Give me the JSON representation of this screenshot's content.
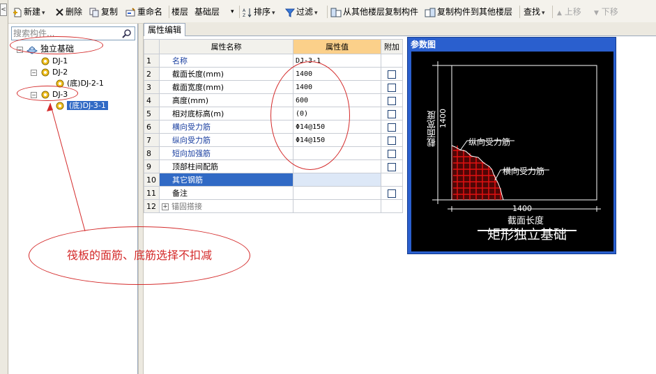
{
  "toolbar": {
    "new_label": "新建",
    "delete_label": "删除",
    "copy_label": "复制",
    "rename_label": "重命名",
    "floor_label": "楼层",
    "floor_value": "基础层",
    "sort_label": "排序",
    "filter_label": "过滤",
    "copy_from_floor_label": "从其他楼层复制构件",
    "copy_to_floor_label": "复制构件到其他楼层",
    "find_label": "查找",
    "move_up_label": "上移",
    "move_down_label": "下移"
  },
  "search": {
    "placeholder": "搜索构件..."
  },
  "tree": {
    "root": "独立基础",
    "items": [
      {
        "label": "DJ-1"
      },
      {
        "label": "DJ-2"
      },
      {
        "label": "(底)DJ-2-1"
      },
      {
        "label": "DJ-3"
      },
      {
        "label": "(底)DJ-3-1"
      }
    ]
  },
  "tab": {
    "label": "属性编辑"
  },
  "grid": {
    "headers": {
      "name": "属性名称",
      "value": "属性值",
      "extra": "附加"
    },
    "rows": [
      {
        "num": "1",
        "name": "名称",
        "value": "DJ-3-1"
      },
      {
        "num": "2",
        "name": "截面长度(mm)",
        "value": "1400"
      },
      {
        "num": "3",
        "name": "截面宽度(mm)",
        "value": "1400"
      },
      {
        "num": "4",
        "name": "高度(mm)",
        "value": "600"
      },
      {
        "num": "5",
        "name": "相对底标高(m)",
        "value": "(0)"
      },
      {
        "num": "6",
        "name": "横向受力筋",
        "value": "Φ14@150"
      },
      {
        "num": "7",
        "name": "纵向受力筋",
        "value": "Φ14@150"
      },
      {
        "num": "8",
        "name": "短向加强筋",
        "value": ""
      },
      {
        "num": "9",
        "name": "顶部柱间配筋",
        "value": ""
      },
      {
        "num": "10",
        "name": "其它钢筋",
        "value": ""
      },
      {
        "num": "11",
        "name": "备注",
        "value": ""
      },
      {
        "num": "12",
        "name": "锚固搭接",
        "value": ""
      }
    ]
  },
  "ref": {
    "title": "参数图",
    "width_dim": "1400",
    "width_label": "截面宽度",
    "length_dim": "1400",
    "length_label": "截面长度",
    "long_bar_label": "纵向受力筋",
    "trans_bar_label": "横向受力筋",
    "caption": "矩形独立基础"
  },
  "annotation": {
    "note": "筏板的面筋、底筋选择不扣减"
  },
  "colors": {
    "annotation": "#d42a2a",
    "selection": "#316ac5",
    "header_highlight": "#fbd08a",
    "rebar": "#e01010"
  }
}
